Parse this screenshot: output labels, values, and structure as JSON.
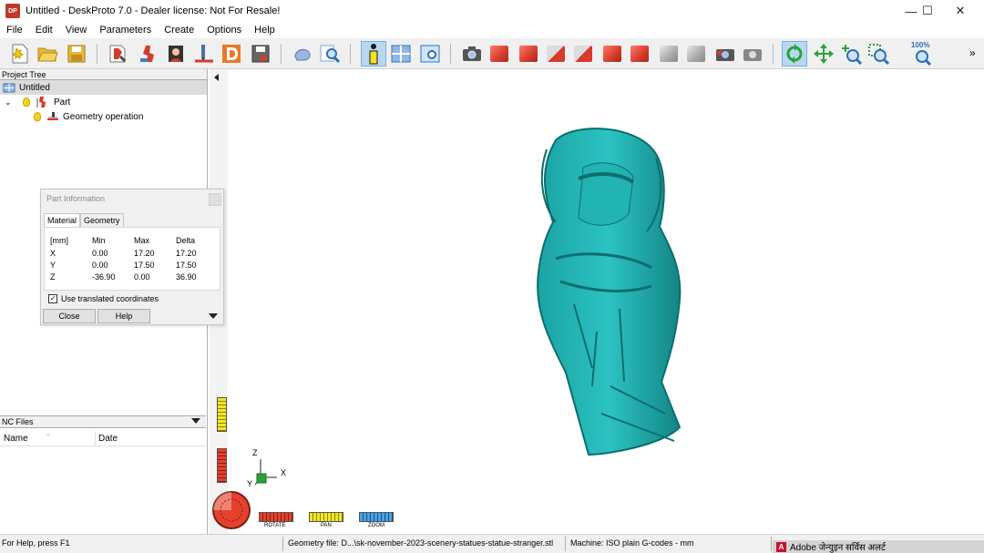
{
  "window": {
    "title": "Untitled - DeskProto 7.0 - Dealer license: Not For Resale!",
    "logo_text": "DP",
    "controls": {
      "minimize": "—",
      "maximize": "☐",
      "close": "✕"
    }
  },
  "menu": [
    "File",
    "Edit",
    "View",
    "Parameters",
    "Create",
    "Options",
    "Help"
  ],
  "toolbar": {
    "zoom_label": "100%",
    "overflow": "»"
  },
  "project_tree": {
    "header": "Project Tree",
    "root": "Untitled",
    "part": "Part",
    "geometry_op": "Geometry operation"
  },
  "nc_files": {
    "header": "NC Files",
    "columns": [
      "Name",
      "Date"
    ]
  },
  "part_info": {
    "title": "Part Information",
    "tabs": [
      "Material",
      "Geometry"
    ],
    "headers": [
      "[mm]",
      "Min",
      "Max",
      "Delta"
    ],
    "rows": [
      [
        "X",
        "0.00",
        "17.20",
        "17.20"
      ],
      [
        "Y",
        "0.00",
        "17.50",
        "17.50"
      ],
      [
        "Z",
        "-36.90",
        "0.00",
        "36.90"
      ]
    ],
    "checkbox_label": "Use translated coordinates",
    "checkbox_checked": true,
    "close_label": "Close",
    "help_label": "Help"
  },
  "viewport": {
    "axis_labels": {
      "z": "Z",
      "x": "X",
      "y": "Y"
    },
    "nav_labels": [
      "ROTATE",
      "PAN",
      "ZOOM"
    ],
    "model_color": "#25b5b5"
  },
  "status": {
    "help": "For Help, press F1",
    "geometry_file": "Geometry file: D...\\sk-november-2023-scenery-statues-statue-stranger.stl",
    "machine": "Machine: ISO plain G-codes - mm"
  },
  "taskbar_alert": {
    "text": "Adobe जेन्युइन सर्विस अलर्ट",
    "icon": "A"
  }
}
